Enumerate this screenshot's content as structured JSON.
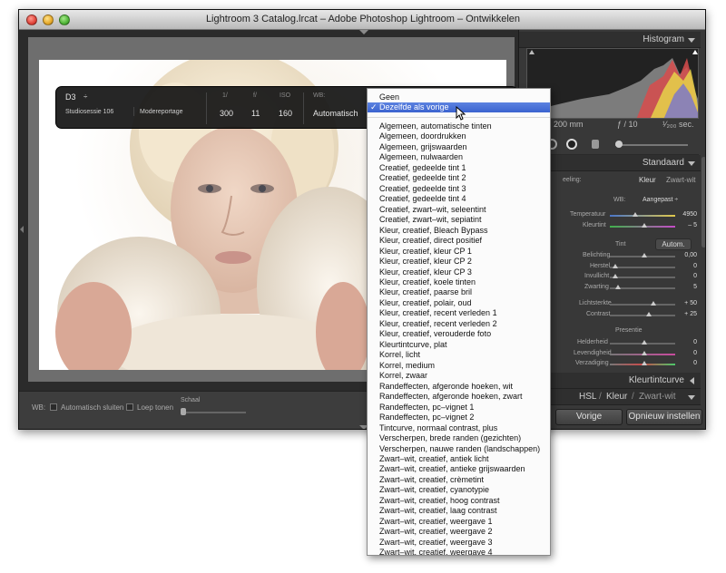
{
  "window": {
    "title": "Lightroom 3 Catalog.lrcat – Adobe Photoshop Lightroom – Ontwikkelen"
  },
  "overlay": {
    "camera": "D3",
    "camera_chevron": "÷",
    "session": "Studiosessie 106",
    "keyword": "Modereportage",
    "shutter_label": "1/",
    "shutter_value": "300",
    "aperture_label": "f/",
    "aperture_value": "11",
    "iso_label": "ISO",
    "iso_value": "160",
    "wb_label": "WB:",
    "wb_value": "Automatisch"
  },
  "toolbar": {
    "wb_label": "WB:",
    "auto_close_label": "Automatisch sluiten",
    "loupe_label": "Loep tonen",
    "scale_label": "Schaal"
  },
  "histogram": {
    "title": "Histogram",
    "focal": "200 mm",
    "aperture": "ƒ / 10",
    "shutter": "¹⁄₂₀₀ sec.",
    "partial_left": "0"
  },
  "basic_panel": {
    "title": "Standaard",
    "treatment_label": "eeling:",
    "color_label": "Kleur",
    "bw_label": "Zwart-wit",
    "wb_label": "WB:",
    "wb_value": "Aangepast ÷",
    "temp_label": "Temperatuur",
    "temp_value": "4950",
    "tint_label": "Kleurtint",
    "tint_value": "– 5",
    "tone_label": "Tint",
    "auto_label": "Autom.",
    "exposure_label": "Belichting",
    "exposure_value": "0,00",
    "recovery_label": "Herstel",
    "recovery_value": "0",
    "fill_label": "Invullicht",
    "fill_value": "0",
    "blacks_label": "Zwarting",
    "blacks_value": "5",
    "brightness_label": "Lichtsterkte",
    "brightness_value": "+ 50",
    "contrast_label": "Contrast",
    "contrast_value": "+ 25",
    "presence_label": "Presentie",
    "clarity_label": "Helderheid",
    "clarity_value": "0",
    "vibrance_label": "Levendigheid",
    "vibrance_value": "0",
    "saturation_label": "Verzadiging",
    "saturation_value": "0"
  },
  "tone_curve": {
    "title": "Kleurtintcurve"
  },
  "hsl": {
    "hsl": "HSL",
    "sep": "/",
    "color": "Kleur",
    "sep2": "/",
    "bw": "Zwart-wit"
  },
  "buttons": {
    "previous": "Vorige",
    "reset": "Opnieuw instellen"
  },
  "menu": {
    "items": [
      "Geen",
      "Dezelfde als vorige",
      "Algemeen, automatische tinten",
      "Algemeen, doordrukken",
      "Algemeen, grijswaarden",
      "Algemeen, nulwaarden",
      "Creatief, gedeelde tint 1",
      "Creatief, gedeelde tint 2",
      "Creatief, gedeelde tint 3",
      "Creatief, gedeelde tint 4",
      "Creatief, zwart–wit, seleentint",
      "Creatief, zwart–wit, sepiatint",
      "Kleur, creatief, Bleach Bypass",
      "Kleur, creatief, direct positief",
      "Kleur, creatief, kleur CP 1",
      "Kleur, creatief, kleur CP 2",
      "Kleur, creatief, kleur CP 3",
      "Kleur, creatief, koele tinten",
      "Kleur, creatief, paarse bril",
      "Kleur, creatief, polair, oud",
      "Kleur, creatief, recent verleden 1",
      "Kleur, creatief, recent verleden 2",
      "Kleur, creatief, verouderde foto",
      "Kleurtintcurve, plat",
      "Korrel, licht",
      "Korrel, medium",
      "Korrel, zwaar",
      "Randeffecten, afgeronde hoeken, wit",
      "Randeffecten, afgeronde hoeken, zwart",
      "Randeffecten, pc–vignet 1",
      "Randeffecten, pc–vignet 2",
      "Tintcurve, normaal contrast, plus",
      "Verscherpen, brede randen (gezichten)",
      "Verscherpen, nauwe randen (landschappen)",
      "Zwart–wit, creatief, antiek licht",
      "Zwart–wit, creatief, antieke grijswaarden",
      "Zwart–wit, creatief, crèmetint",
      "Zwart–wit, creatief, cyanotypie",
      "Zwart–wit, creatief, hoog contrast",
      "Zwart–wit, creatief, laag contrast",
      "Zwart–wit, creatief, weergave 1",
      "Zwart–wit, creatief, weergave 2",
      "Zwart–wit, creatief, weergave 3",
      "Zwart–wit, creatief, weergave 4"
    ],
    "selected_index": 1,
    "check": "✓"
  },
  "colors": {
    "selection": "#3a63cf",
    "panel": "#383838",
    "window": "#2b2b2b",
    "photo_bg": "#ffffff"
  }
}
